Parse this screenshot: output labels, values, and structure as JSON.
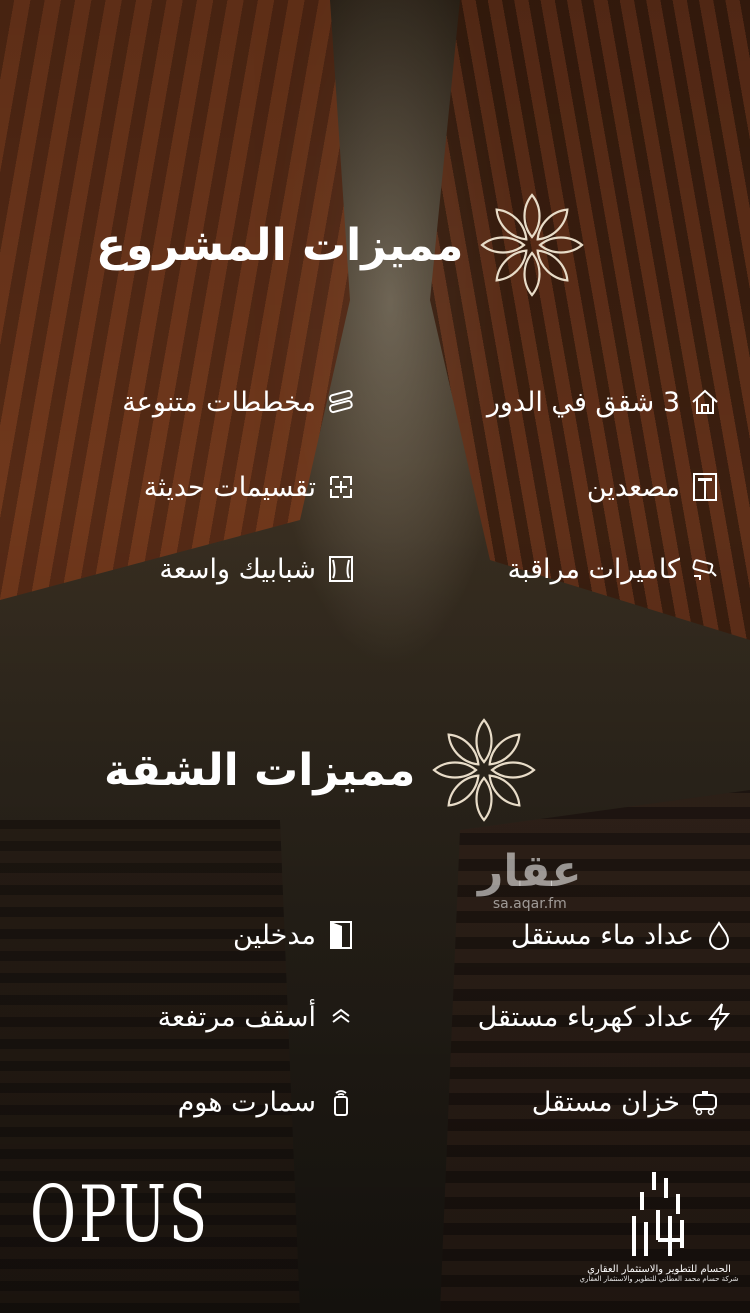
{
  "project_features": {
    "title": "مميزات المشروع",
    "items": [
      {
        "label": "3 شقق في الدور",
        "icon": "house-icon"
      },
      {
        "label": "مخططات متنوعة",
        "icon": "blueprint-icon"
      },
      {
        "label": "مصعدين",
        "icon": "elevator-icon"
      },
      {
        "label": "تقسيمات حديثة",
        "icon": "floorplan-icon"
      },
      {
        "label": "كاميرات مراقبة",
        "icon": "camera-icon"
      },
      {
        "label": "شبابيك واسعة",
        "icon": "window-icon"
      }
    ]
  },
  "apartment_features": {
    "title": "مميزات الشقة",
    "items": [
      {
        "label": "عداد ماء مستقل",
        "icon": "water-drop-icon"
      },
      {
        "label": "مدخلين",
        "icon": "door-icon"
      },
      {
        "label": "عداد كهرباء مستقل",
        "icon": "lightning-icon"
      },
      {
        "label": "أسقف مرتفعة",
        "icon": "chevron-up-icon"
      },
      {
        "label": "خزان مستقل",
        "icon": "tank-icon"
      },
      {
        "label": "سمارت هوم",
        "icon": "smartphone-icon"
      }
    ]
  },
  "watermark": {
    "brand": "عقار",
    "url": "sa.aqar.fm"
  },
  "brand_opus": "OPUS",
  "logo": {
    "line1": "الحسام للتطوير والاستثمار العقاري",
    "line2": "شركة حسام محمد العطاني للتطوير والاستثمار العقاري"
  },
  "colors": {
    "text": "#ffffff",
    "accent": "#e8dcc8"
  }
}
